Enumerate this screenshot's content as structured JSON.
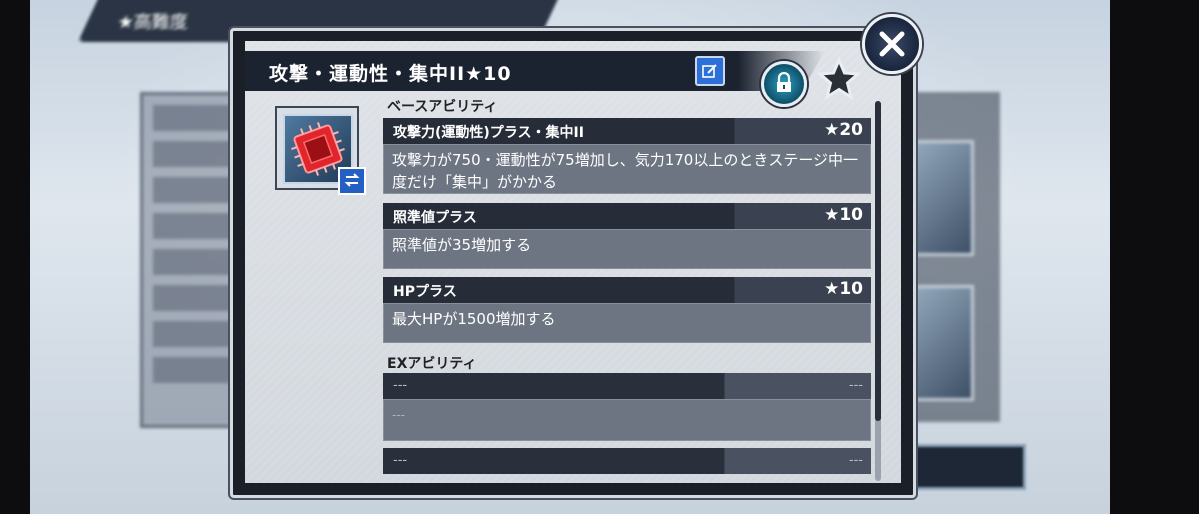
{
  "background": {
    "back_label": "★高難度"
  },
  "modal": {
    "title": "攻撃・運動性・集中II★10",
    "edit_icon": "edit-icon",
    "lock_icon": "lock-icon",
    "star_icon": "star-icon",
    "close_icon": "close-icon"
  },
  "item": {
    "icon": "chip-icon",
    "swap_icon": "swap-icon"
  },
  "base_section_label": "ベースアビリティ",
  "base_abilities": [
    {
      "name": "攻撃力(運動性)プラス・集中II",
      "rank": "★20",
      "desc": "攻撃力が750・運動性が75増加し、気力170以上のときステージ中一度だけ「集中」がかかる"
    },
    {
      "name": "照準値プラス",
      "rank": "★10",
      "desc": "照準値が35増加する"
    },
    {
      "name": "HPプラス",
      "rank": "★10",
      "desc": "最大HPが1500増加する"
    }
  ],
  "ex_section_label": "EXアビリティ",
  "ex_abilities": [
    {
      "name": "---",
      "rank": "---",
      "desc": "---"
    },
    {
      "name": "---",
      "rank": "---",
      "desc": ""
    }
  ],
  "colors": {
    "title_bar": "#1c2330",
    "ability_body": "#6e7582",
    "edit_button": "#2d6fd9",
    "lock_button": "#2ba2c7",
    "chip_red": "#e0262c"
  }
}
